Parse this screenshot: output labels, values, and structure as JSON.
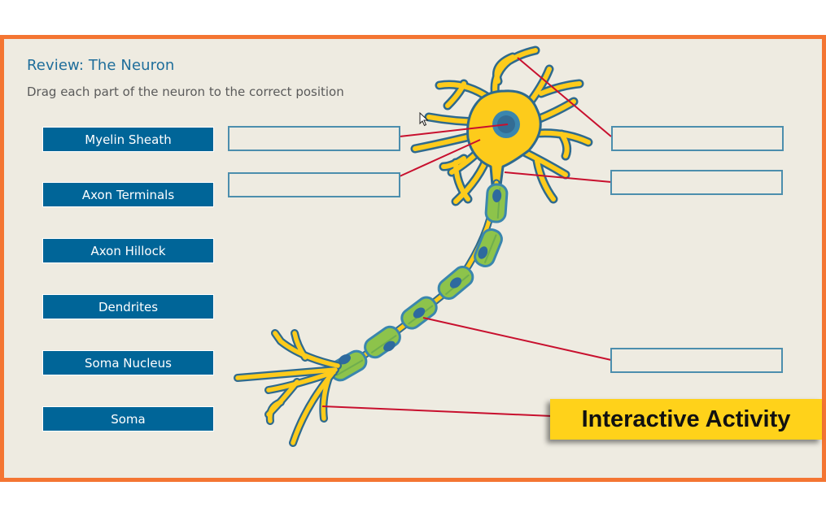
{
  "activity": {
    "title": "Review: The Neuron",
    "instruction": "Drag each part of the neuron to the correct position"
  },
  "parts": [
    {
      "label": "Myelin Sheath"
    },
    {
      "label": "Axon Terminals"
    },
    {
      "label": "Axon Hillock"
    },
    {
      "label": "Dendrites"
    },
    {
      "label": "Soma Nucleus"
    },
    {
      "label": "Soma"
    }
  ],
  "drop_zones": [
    {
      "id": "left-1",
      "value": ""
    },
    {
      "id": "left-2",
      "value": ""
    },
    {
      "id": "right-1",
      "value": ""
    },
    {
      "id": "right-2",
      "value": ""
    },
    {
      "id": "right-3",
      "value": ""
    }
  ],
  "badge": {
    "label": "Interactive Activity"
  },
  "colors": {
    "frame": "#F47532",
    "background": "#EEEBE1",
    "title": "#1F6E9B",
    "part_button": "#006598",
    "drop_border": "#4C8EAD",
    "leader_line": "#C8102E",
    "neuron_body": "#FDCB1B",
    "neuron_outline": "#2E6A8E",
    "myelin": "#8DC34B",
    "badge": "#FFD21A"
  }
}
